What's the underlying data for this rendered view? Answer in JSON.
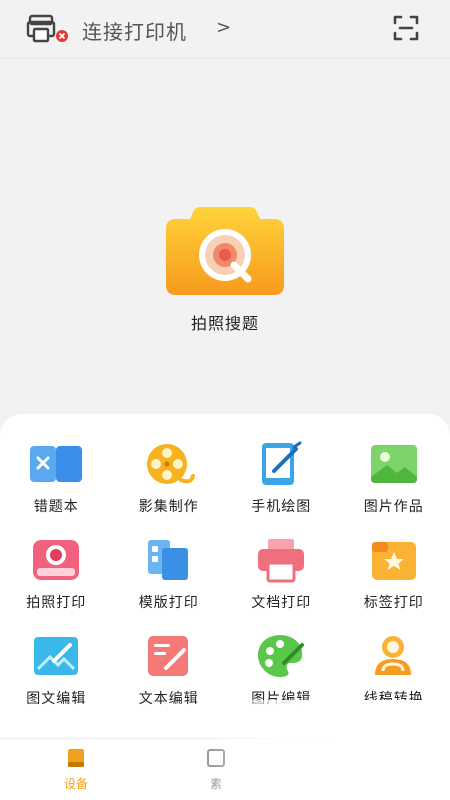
{
  "header": {
    "connect_label": "连接打印机",
    "chevron": ">"
  },
  "hero": {
    "label": "拍照搜题"
  },
  "tools": [
    {
      "label": "错题本",
      "icon": "mistake-book-icon"
    },
    {
      "label": "影集制作",
      "icon": "film-reel-icon"
    },
    {
      "label": "手机绘图",
      "icon": "phone-drawing-icon"
    },
    {
      "label": "图片作品",
      "icon": "picture-gallery-icon"
    },
    {
      "label": "拍照打印",
      "icon": "photo-print-icon"
    },
    {
      "label": "模版打印",
      "icon": "template-print-icon"
    },
    {
      "label": "文档打印",
      "icon": "document-print-icon"
    },
    {
      "label": "标签打印",
      "icon": "label-print-icon"
    },
    {
      "label": "图文编辑",
      "icon": "image-text-edit-icon"
    },
    {
      "label": "文本编辑",
      "icon": "text-edit-icon"
    },
    {
      "label": "图片编辑",
      "icon": "palette-icon"
    },
    {
      "label": "线稿转换",
      "icon": "line-art-convert-icon"
    }
  ],
  "nav": {
    "device_label": "设备",
    "second_label_partial": "素"
  },
  "colors": {
    "accent": "#f2a21a",
    "camera_orange": "#f7a823",
    "camera_yellow": "#ffd33a"
  }
}
